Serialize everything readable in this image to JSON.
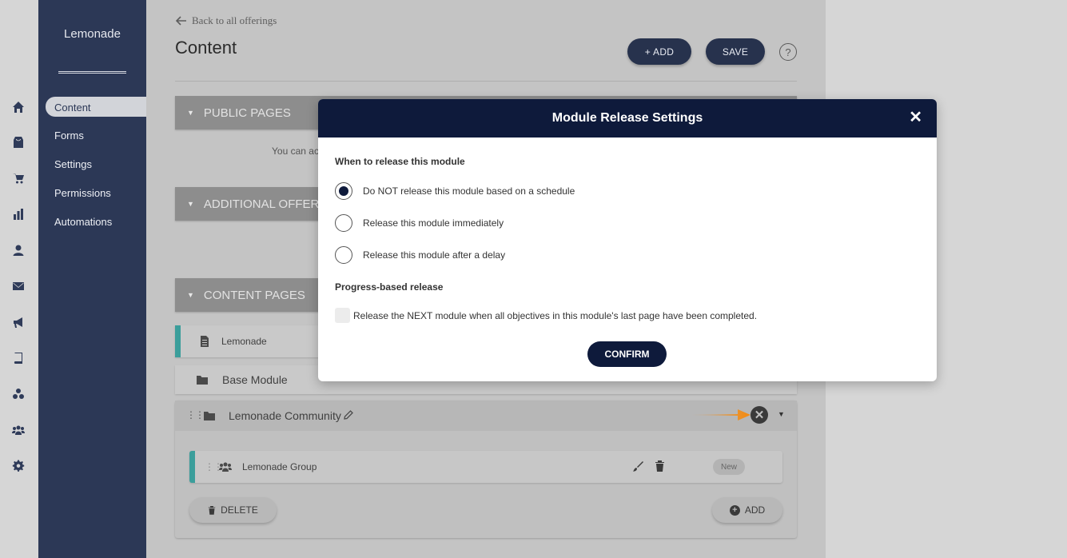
{
  "app": {
    "brand": "Lemonade"
  },
  "rail": {
    "icons": [
      "home-icon",
      "store-icon",
      "cart-icon",
      "bar-chart-icon",
      "user-icon",
      "mail-icon",
      "megaphone-icon",
      "book-icon",
      "community-icon",
      "group-icon",
      "gear-icon"
    ]
  },
  "sidebar": {
    "items": [
      {
        "label": "Content",
        "active": true
      },
      {
        "label": "Forms"
      },
      {
        "label": "Settings"
      },
      {
        "label": "Permissions"
      },
      {
        "label": "Automations"
      }
    ]
  },
  "header": {
    "back_label": "Back to all offerings",
    "title": "Content",
    "add_label": "+ ADD",
    "save_label": "SAVE",
    "help_label": "?"
  },
  "sections": {
    "public_pages": "PUBLIC PAGES",
    "public_note": "You can ac",
    "additional": "ADDITIONAL OFFERIN",
    "content_pages": "CONTENT PAGES"
  },
  "rows": {
    "lemonade_page": "Lemonade",
    "base_module": "Base Module",
    "community_module": "Lemonade Community",
    "group_item": "Lemonade Group",
    "new_badge": "New",
    "delete_label": "DELETE",
    "add_label": "ADD"
  },
  "modal": {
    "title": "Module Release Settings",
    "close": "✕",
    "when_heading": "When to release this module",
    "options": [
      {
        "label": "Do NOT release this module based on a schedule",
        "selected": true
      },
      {
        "label": "Release this module immediately",
        "selected": false
      },
      {
        "label": "Release this module after a delay",
        "selected": false
      }
    ],
    "progress_heading": "Progress-based release",
    "progress_checkbox": "Release the NEXT module when all objectives in this module's last page have been completed.",
    "progress_checked": false,
    "confirm_label": "CONFIRM"
  },
  "colors": {
    "sidebar": "#2c3856",
    "modal_header": "#0e1a3b",
    "highlight": "#f58a0e",
    "teal_accent": "#3b9e9b"
  }
}
